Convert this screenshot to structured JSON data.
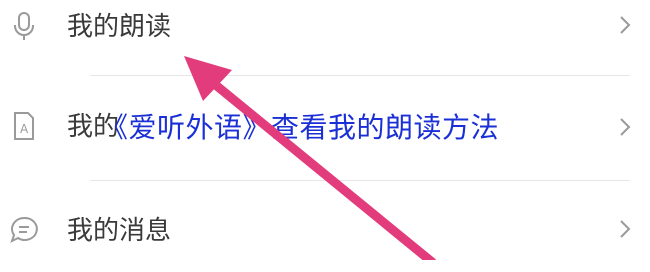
{
  "menu": {
    "items": [
      {
        "label": "我的朗读",
        "icon": "microphone-icon"
      },
      {
        "label": "我的",
        "icon": "font-document-icon"
      },
      {
        "label": "我的消息",
        "icon": "chat-bubble-icon"
      }
    ]
  },
  "overlay": {
    "caption": "《爱听外语》查看我的朗读方法"
  },
  "colors": {
    "arrow": "#e23c7c",
    "caption": "#1a2fd6",
    "label": "#3a3a3a",
    "icon": "#9a9a9a"
  }
}
